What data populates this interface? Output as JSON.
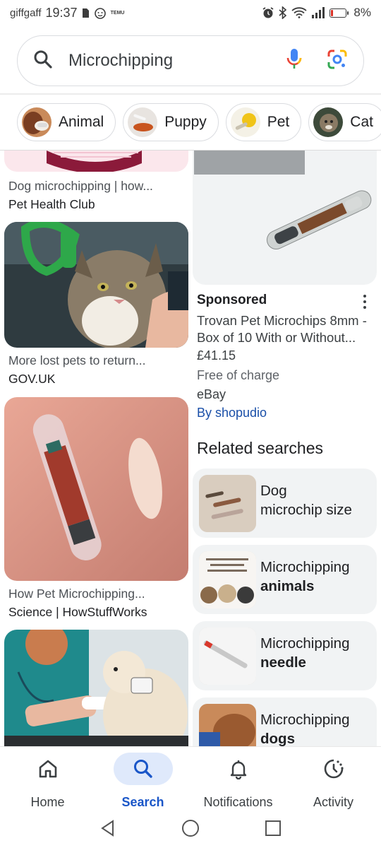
{
  "status_bar": {
    "carrier": "giffgaff",
    "time": "19:37",
    "notification_text": "TEMU",
    "battery_percent": "8%"
  },
  "search": {
    "query": "Microchipping"
  },
  "chips": [
    {
      "label": "Animal"
    },
    {
      "label": "Puppy"
    },
    {
      "label": "Pet"
    },
    {
      "label": "Cat"
    }
  ],
  "results_left": [
    {
      "title": "Dog microchipping | how...",
      "source": "Pet Health Club"
    },
    {
      "title": "More lost pets to return...",
      "source": "GOV.UK"
    },
    {
      "title": "How Pet Microchipping...",
      "source": "Science | HowStuffWorks"
    }
  ],
  "ad": {
    "sponsored_label": "Sponsored",
    "title": "Trovan Pet Microchips 8mm - Box of 10 With or Without...",
    "price": "£41.15",
    "shipping": "Free of charge",
    "store": "eBay",
    "seller": "By shopudio"
  },
  "related": {
    "heading": "Related searches",
    "items": [
      {
        "line1": "Dog",
        "line2": "microchip size",
        "bold": false
      },
      {
        "line1": "Microchipping",
        "line2": "animals",
        "bold": true
      },
      {
        "line1": "Microchipping",
        "line2": "needle",
        "bold": true
      },
      {
        "line1": "Microchipping",
        "line2": "dogs",
        "bold": true
      }
    ]
  },
  "bottom_nav": {
    "items": [
      {
        "label": "Home",
        "icon": "home-icon"
      },
      {
        "label": "Search",
        "icon": "search-icon",
        "active": true
      },
      {
        "label": "Notifications",
        "icon": "bell-icon"
      },
      {
        "label": "Activity",
        "icon": "activity-icon"
      }
    ]
  },
  "colors": {
    "accent_blue": "#1a56c8",
    "active_pill": "#dfe9fb",
    "link_blue": "#1a4fa8"
  }
}
